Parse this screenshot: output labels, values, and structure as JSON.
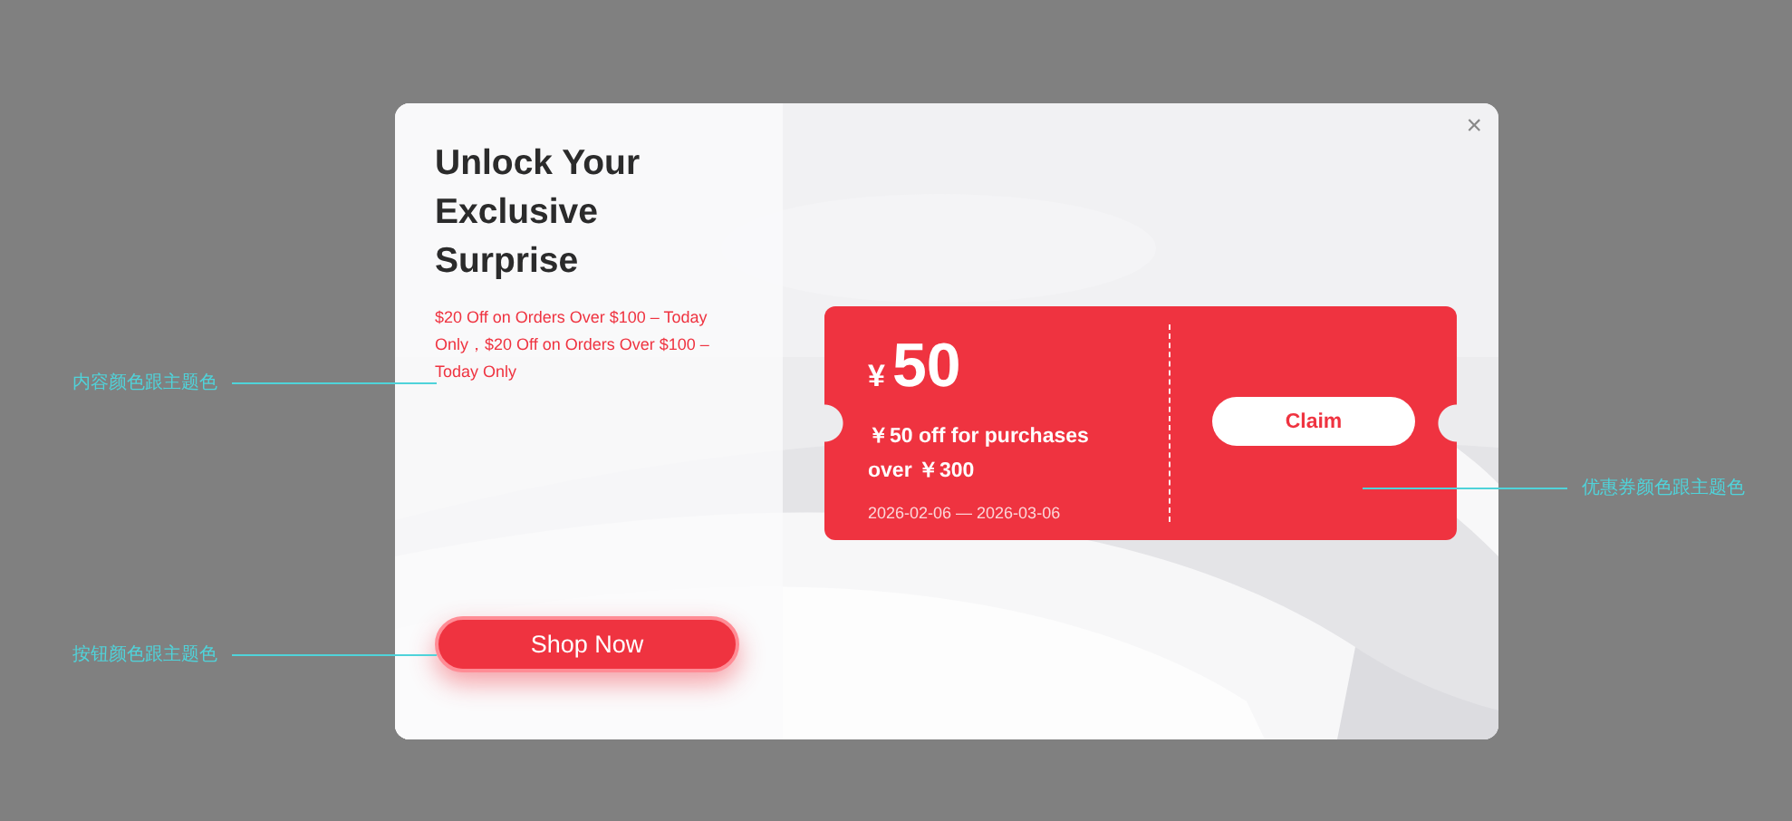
{
  "annotations": [
    {
      "text": "内容颜色跟主题色",
      "kind": "leftlabel"
    },
    {
      "text": "按钮颜色跟主题色",
      "kind": "leftlabel"
    },
    {
      "text": "优惠券颜色跟主题色",
      "kind": "rightlabel"
    }
  ],
  "popup": {
    "close": "×",
    "title": "Unlock Your Exclusive Surprise",
    "description": "$20 Off on Orders Over $100 – Today Only，$20 Off on Orders Over $100 – Today Only",
    "button": "Shop Now",
    "coupon": {
      "currency": "¥",
      "amount": "50",
      "condition": "￥50 off for purchases over ￥300",
      "validity": "2026-02-06 — 2026-03-06",
      "button": "Claim"
    }
  }
}
